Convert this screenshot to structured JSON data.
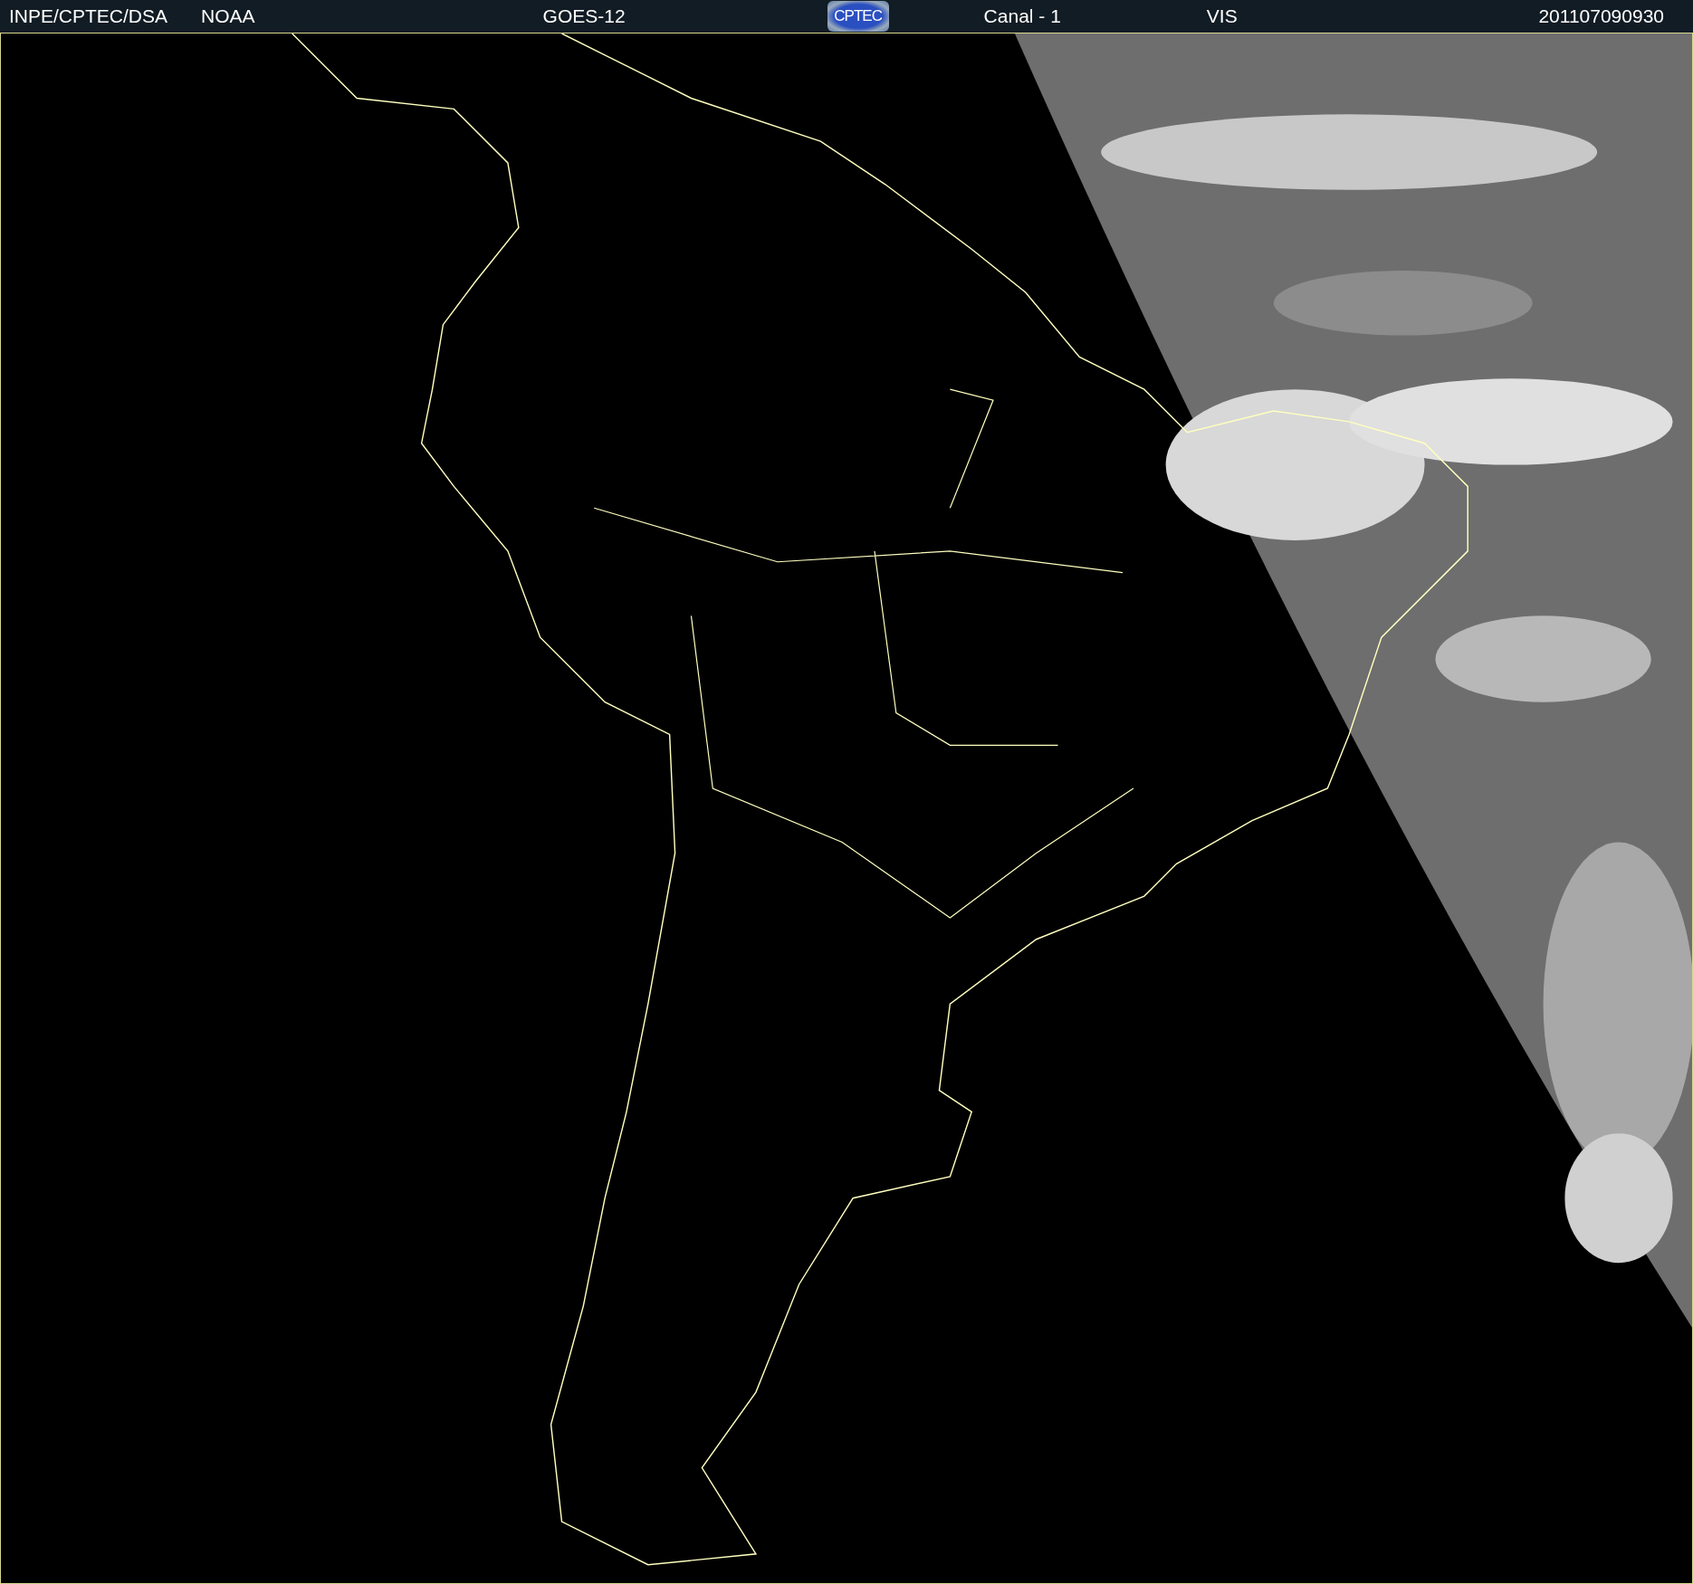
{
  "header": {
    "source": "INPE/CPTEC/DSA",
    "agency": "NOAA",
    "satellite": "GOES-12",
    "logo_text": "CPTEC",
    "channel": "Canal - 1",
    "band": "VIS",
    "timestamp": "201107090930"
  }
}
